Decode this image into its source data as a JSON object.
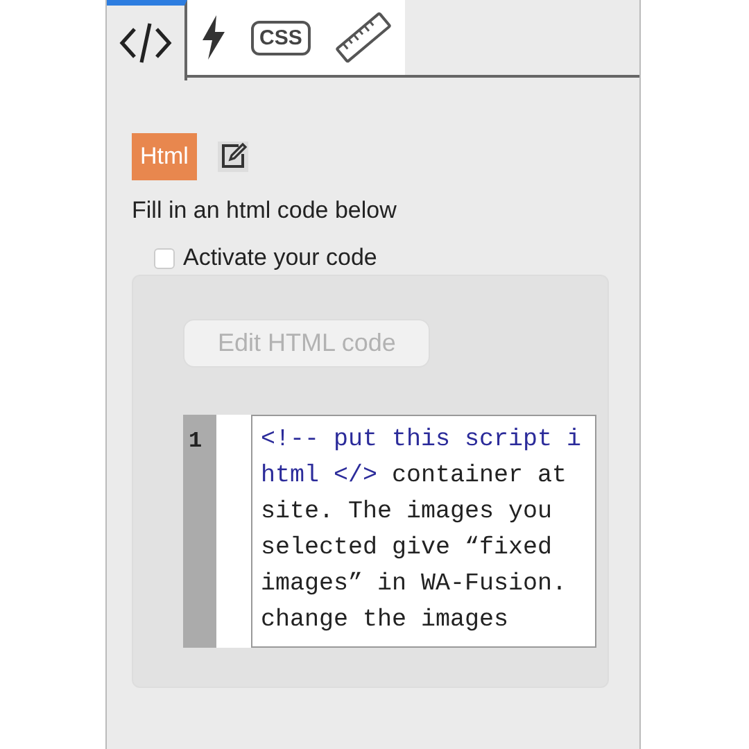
{
  "tabs": [
    {
      "kind": "code",
      "selected": true
    },
    {
      "kind": "bolt",
      "selected": false
    },
    {
      "kind": "css",
      "label": "CSS",
      "selected": false
    },
    {
      "kind": "ruler",
      "selected": false
    }
  ],
  "badge": "Html",
  "instruction": "Fill in an html code below",
  "activate": {
    "label": "Activate your code",
    "checked": false
  },
  "edit_button": {
    "label": "Edit HTML code",
    "disabled": true
  },
  "editor": {
    "line_number": "1",
    "lines": [
      [
        {
          "text": "<!-- put this script i",
          "kind": "comment"
        }
      ],
      [
        {
          "text": "html </>",
          "kind": "comment"
        },
        {
          "text": " container at",
          "kind": "plain"
        }
      ],
      [
        {
          "text": "site. The images you",
          "kind": "plain"
        }
      ],
      [
        {
          "text": "selected give “fixed",
          "kind": "plain"
        }
      ],
      [
        {
          "text": "images” in WA-Fusion.",
          "kind": "plain"
        }
      ],
      [
        {
          "text": "change the images",
          "kind": "plain"
        }
      ]
    ]
  }
}
